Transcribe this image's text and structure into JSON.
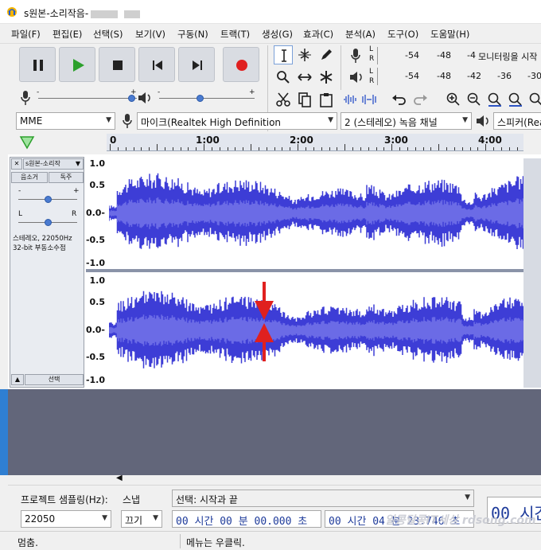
{
  "window": {
    "title": "s원본-소리작음-",
    "watermark": "알콩달콩IT세상 rdsong.com"
  },
  "menu": [
    "파일(F)",
    "편집(E)",
    "선택(S)",
    "보기(V)",
    "구동(N)",
    "트랙(T)",
    "생성(G)",
    "효과(C)",
    "분석(A)",
    "도구(O)",
    "도움말(H)"
  ],
  "meters": {
    "record_ticks": [
      "-54",
      "-48",
      "-4",
      "모니터링을 시작"
    ],
    "play_ticks": [
      "-54",
      "-48",
      "-42",
      "-36",
      "-30"
    ],
    "lr": [
      "L",
      "R"
    ]
  },
  "device": {
    "host": "MME",
    "mic": "마이크(Realtek High Definition",
    "channels": "2 (스테레오) 녹음 채널",
    "speaker": "스피커(Rea"
  },
  "timeline": {
    "labels": [
      "0",
      "1:00",
      "2:00",
      "3:00",
      "4:00"
    ]
  },
  "track": {
    "name": "s원본-소리작",
    "mute": "음소거",
    "solo": "독주",
    "gain_minus": "-",
    "gain_plus": "+",
    "pan_l": "L",
    "pan_r": "R",
    "info_line1": "스테레오, 22050Hz",
    "info_line2": "32-bit 부동소수점",
    "select": "선택",
    "amp_top": [
      "1.0",
      "0.5",
      "0.0-",
      "-0.5",
      "-1.0"
    ],
    "amp_bottom": [
      "1.0",
      "0.5",
      "0.0-",
      "-0.5",
      "-1.0"
    ]
  },
  "selection_bar": {
    "rate_label": "프로젝트 샘플링(Hz):",
    "rate_value": "22050",
    "snap_label": "스냅",
    "snap_value": "끄기",
    "sel_label": "선택: 시작과 끝",
    "start_time": "00 시간 00 분 00.000 초",
    "end_time": "00 시간 04 분 23.746 초",
    "pos_time": "00 시간"
  },
  "status": {
    "left": "멈춤.",
    "right": "메뉴는 우클릭."
  },
  "colors": {
    "waveform": "#3d3dd6",
    "waveform_rms": "#6b6be6",
    "arrow": "#e0201f",
    "record": "#e02020",
    "play": "#2ca02c"
  }
}
